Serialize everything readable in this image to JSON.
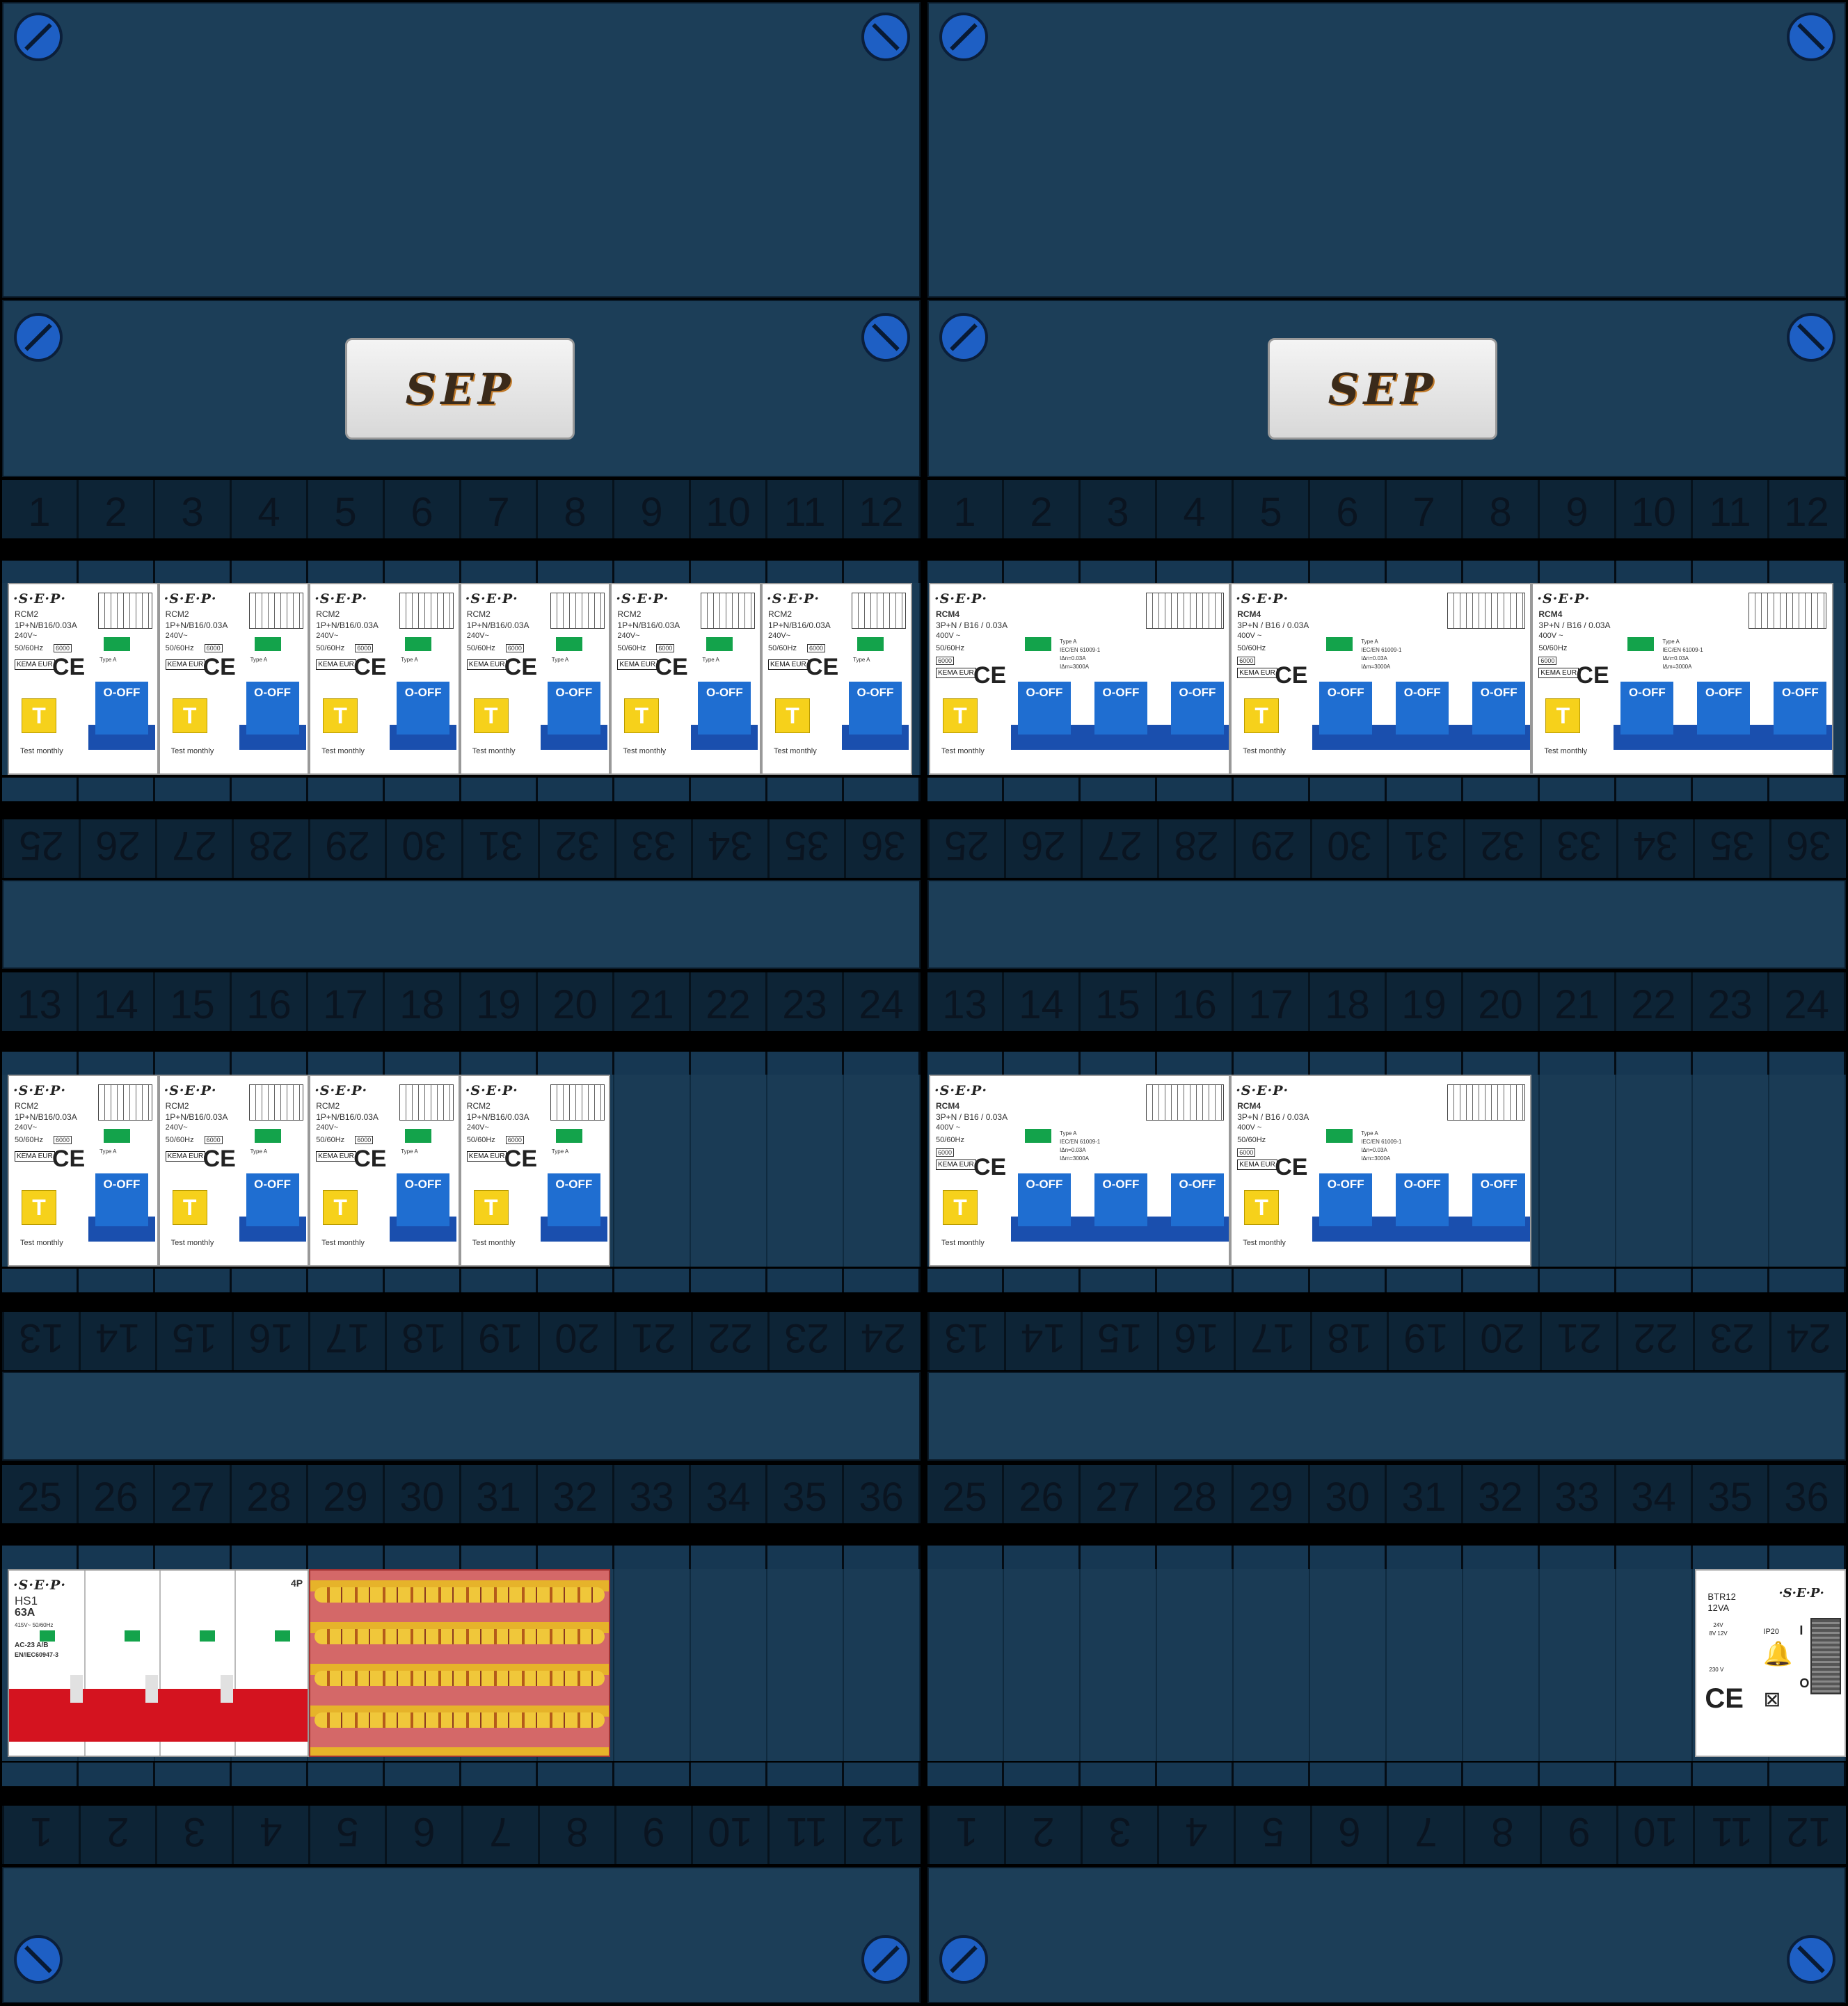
{
  "panels": [
    {
      "id": "left",
      "logo_text": "SEP",
      "numbers_row1": [
        "1",
        "2",
        "3",
        "4",
        "5",
        "6",
        "7",
        "8",
        "9",
        "10",
        "11",
        "12"
      ],
      "numbers_row1_rev": [
        "36",
        "35",
        "34",
        "33",
        "32",
        "31",
        "30",
        "29",
        "28",
        "27",
        "26",
        "25"
      ],
      "numbers_row2": [
        "13",
        "14",
        "15",
        "16",
        "17",
        "18",
        "19",
        "20",
        "21",
        "22",
        "23",
        "24"
      ],
      "numbers_row2_rev": [
        "24",
        "23",
        "22",
        "21",
        "20",
        "19",
        "18",
        "17",
        "16",
        "15",
        "14",
        "13"
      ],
      "numbers_row3": [
        "25",
        "26",
        "27",
        "28",
        "29",
        "30",
        "31",
        "32",
        "33",
        "34",
        "35",
        "36"
      ],
      "numbers_row3_rev": [
        "12",
        "11",
        "10",
        "9",
        "8",
        "7",
        "6",
        "5",
        "4",
        "3",
        "2",
        "1"
      ]
    },
    {
      "id": "right",
      "logo_text": "SEP",
      "numbers_row1": [
        "1",
        "2",
        "3",
        "4",
        "5",
        "6",
        "7",
        "8",
        "9",
        "10",
        "11",
        "12"
      ],
      "numbers_row1_rev": [
        "36",
        "35",
        "34",
        "33",
        "32",
        "31",
        "30",
        "29",
        "28",
        "27",
        "26",
        "25"
      ],
      "numbers_row2": [
        "13",
        "14",
        "15",
        "16",
        "17",
        "18",
        "19",
        "20",
        "21",
        "22",
        "23",
        "24"
      ],
      "numbers_row2_rev": [
        "24",
        "23",
        "22",
        "21",
        "20",
        "19",
        "18",
        "17",
        "16",
        "15",
        "14",
        "13"
      ],
      "numbers_row3": [
        "25",
        "26",
        "27",
        "28",
        "29",
        "30",
        "31",
        "32",
        "33",
        "34",
        "35",
        "36"
      ],
      "numbers_row3_rev": [
        "12",
        "11",
        "10",
        "9",
        "8",
        "7",
        "6",
        "5",
        "4",
        "3",
        "2",
        "1"
      ]
    }
  ],
  "rcm2": {
    "brand": "·S·E·P·",
    "model": "RCM2",
    "rating": "1P+N/B16/0.03A",
    "voltage": "240V~",
    "freq": "50/60Hz",
    "cap": "6000",
    "kema": "KEMA EUR",
    "ce": "CE",
    "test_btn": "T",
    "off_label": "O-OFF",
    "footer": "Test   monthly",
    "type_label": "Type A"
  },
  "rcm4": {
    "brand": "·S·E·P·",
    "model": "RCM4",
    "rating": "3P+N / B16 / 0.03A",
    "voltage": "400V ~",
    "freq": "50/60Hz",
    "cap": "6000",
    "kema": "KEMA EUR",
    "ce": "CE",
    "test_btn": "T",
    "off_label": "O-OFF",
    "footer": "Test   monthly",
    "type_label": "Type A",
    "std": "IEC/EN 61009-1",
    "idn": "IΔn=0.03A",
    "idm": "IΔm=3000A"
  },
  "hs1": {
    "brand": "·S·E·P·",
    "model": "HS1",
    "amps": "63A",
    "volts": "415V~   50/60Hz",
    "ac": "AC-23 A/B",
    "std": "EN/IEC60947-3",
    "poles": "4P"
  },
  "btr": {
    "brand": "·S·E·P·",
    "model": "BTR12",
    "va": "12VA",
    "ip": "IP20",
    "v24": "24V",
    "v8": "8V 12V",
    "v230": "230 V",
    "ce": "CE",
    "on": "I",
    "off": "O"
  },
  "counts": {
    "left_row1_rcm2": 6,
    "left_row2_rcm2": 4,
    "right_row1_rcm4": 3,
    "right_row2_rcm4": 2
  }
}
